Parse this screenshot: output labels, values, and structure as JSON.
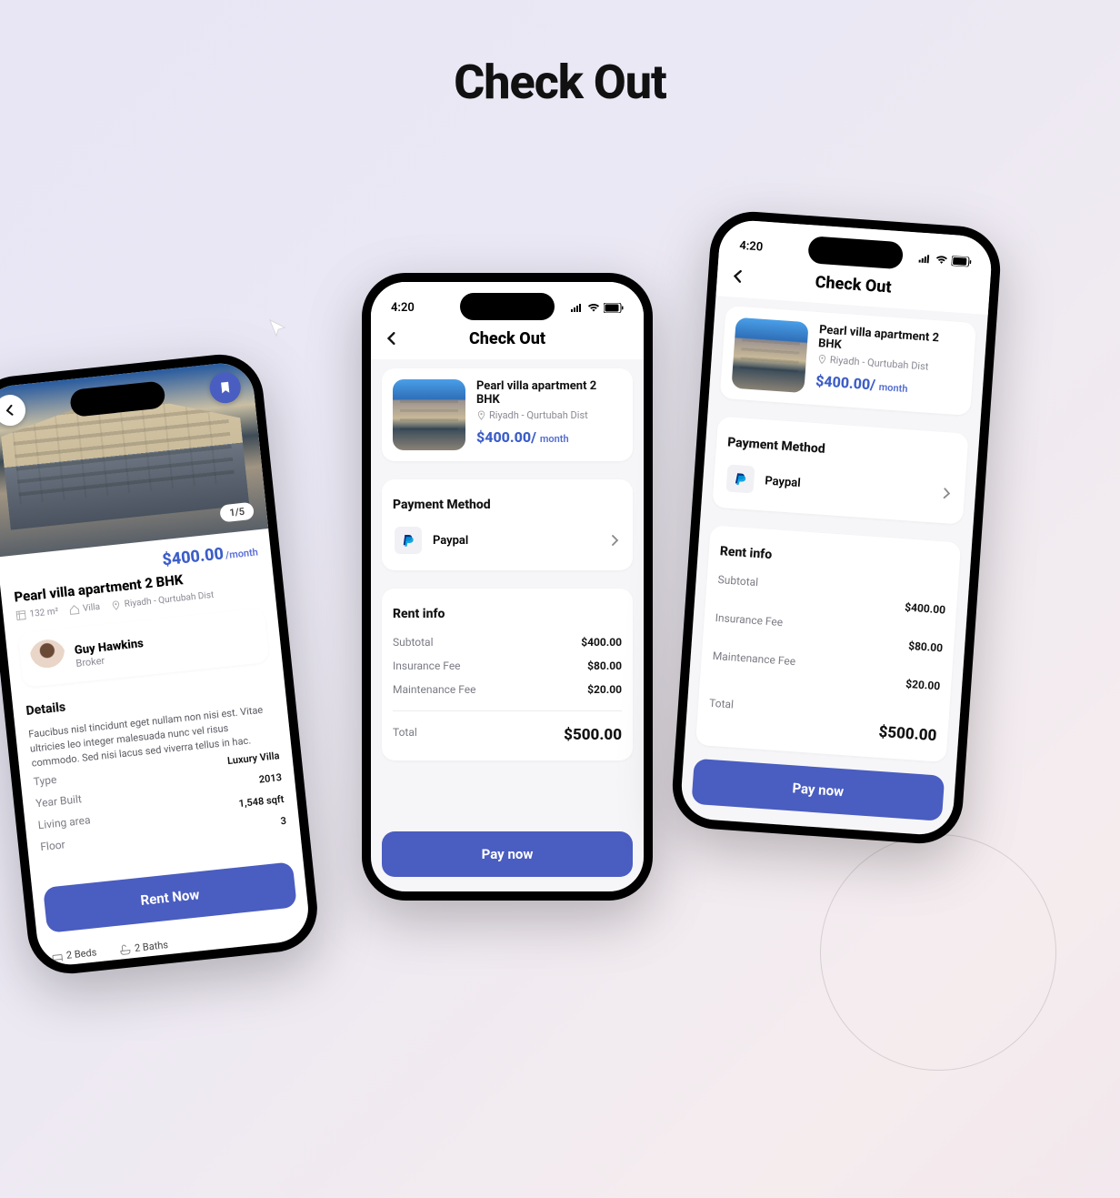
{
  "page": {
    "title": "Check Out"
  },
  "status": {
    "time": "4:20"
  },
  "detail": {
    "title": "Check Out",
    "pager": "1/5",
    "property": {
      "name": "Pearl villa apartment 2 BHK",
      "price": "$400.00",
      "period": "/month",
      "area": "132 m²",
      "type": "Villa",
      "location": "Riyadh - Qurtubah Dist"
    },
    "broker": {
      "name": "Guy Hawkins",
      "role": "Broker"
    },
    "details_heading": "Details",
    "details_desc": "Faucibus nisl tincidunt eget nullam non nisi est. Vitae ultricies leo integer malesuada nunc vel risus commodo. Sed nisi lacus sed viverra tellus in hac.",
    "specs": {
      "type_label": "Type",
      "type_value": "Luxury Villa",
      "year_label": "Year Built",
      "year_value": "2013",
      "area_label": "Living area",
      "area_value": "1,548 sqft",
      "floor_label": "Floor",
      "floor_value": "3"
    },
    "cta": "Rent Now",
    "chips": {
      "beds": "2 Beds",
      "baths": "2 Baths"
    }
  },
  "checkout": {
    "title": "Check Out",
    "property": {
      "name": "Pearl villa apartment 2 BHK",
      "location": "Riyadh - Qurtubah Dist",
      "price": "$400.00/",
      "period": "month"
    },
    "payment_section": "Payment Method",
    "payment_method": "Paypal",
    "rent_section": "Rent info",
    "rows": {
      "subtotal_label": "Subtotal",
      "subtotal_value": "$400.00",
      "insurance_label": "Insurance Fee",
      "insurance_value": "$80.00",
      "maintenance_label": "Maintenance Fee",
      "maintenance_value": "$20.00",
      "total_label": "Total",
      "total_value": "$500.00"
    },
    "cta": "Pay now"
  }
}
